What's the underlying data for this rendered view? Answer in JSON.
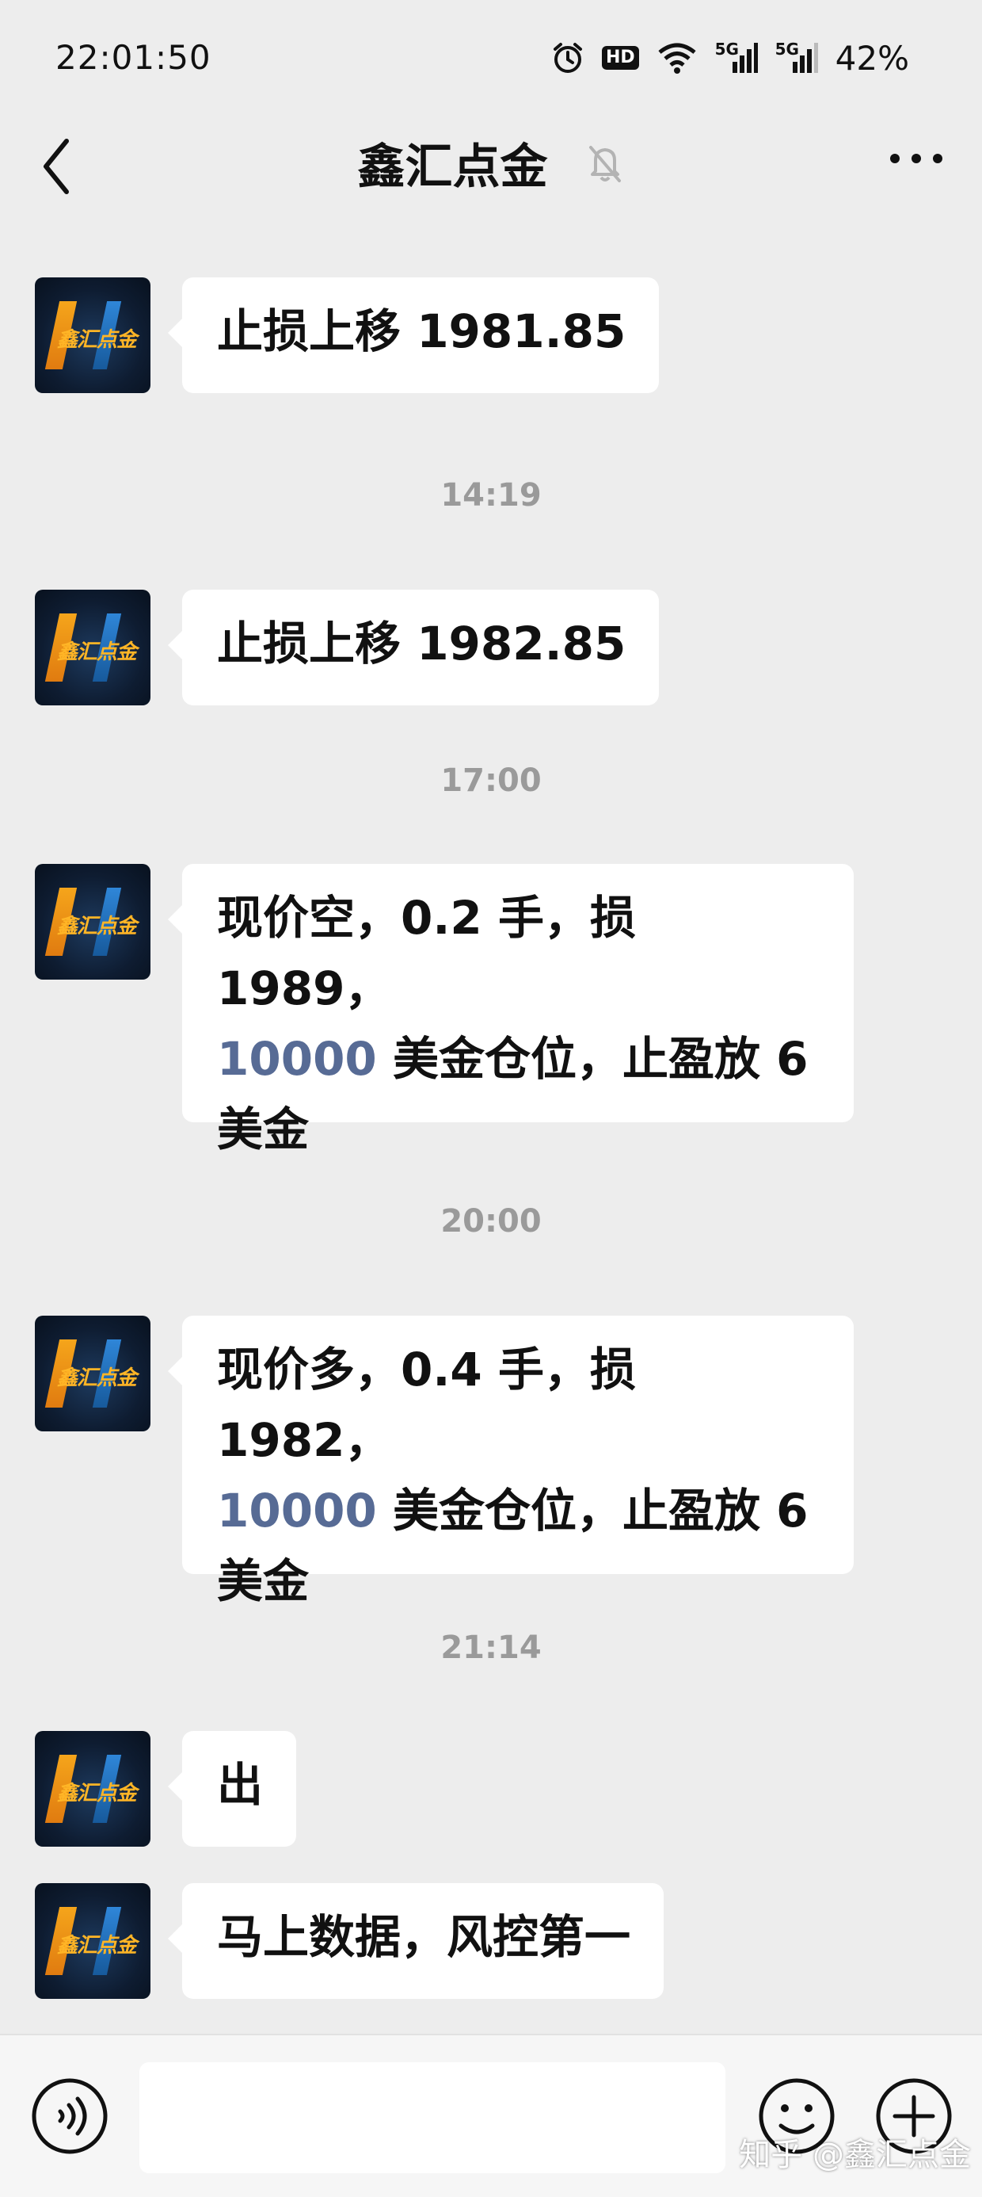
{
  "status_bar": {
    "time": "22:01:50",
    "hd_label": "HD",
    "network_label": "5G",
    "battery": "42%"
  },
  "header": {
    "title": "鑫汇点金"
  },
  "contact": {
    "avatar_text": "鑫汇点金"
  },
  "messages": [
    {
      "type": "text",
      "parts": [
        "止损上移 1981.85"
      ]
    },
    {
      "type": "time",
      "text": "14:19"
    },
    {
      "type": "text",
      "parts": [
        "止损上移 1982.85"
      ]
    },
    {
      "type": "time",
      "text": "17:00"
    },
    {
      "type": "text",
      "parts": [
        "现价空，0.2 手，损 1989，",
        "10000",
        " 美金仓位，止盈放 6",
        "美金"
      ]
    },
    {
      "type": "time",
      "text": "20:00"
    },
    {
      "type": "text",
      "parts": [
        "现价多，0.4 手，损 1982，",
        "10000",
        " 美金仓位，止盈放 6",
        "美金"
      ]
    },
    {
      "type": "time",
      "text": "21:14"
    },
    {
      "type": "text",
      "parts": [
        "出"
      ]
    },
    {
      "type": "text",
      "parts": [
        "马上数据，风控第一"
      ]
    }
  ],
  "input_bar": {
    "placeholder": "",
    "value": ""
  },
  "watermark": "知乎 @鑫汇点金",
  "colors": {
    "background": "#ededed",
    "bubble": "#ffffff",
    "link_number": "#576b95",
    "timestamp": "#9a9a9a"
  },
  "icons": [
    "back-icon",
    "mute-bell-icon",
    "more-icon",
    "voice-icon",
    "emoji-icon",
    "plus-icon",
    "alarm-icon",
    "wifi-icon",
    "signal-icon"
  ]
}
